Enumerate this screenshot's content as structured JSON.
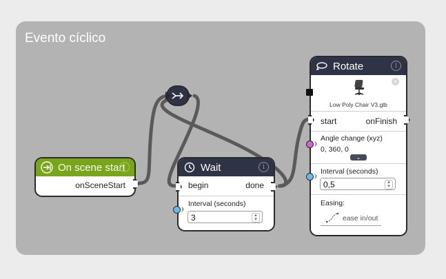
{
  "group": {
    "title": "Evento cíclico"
  },
  "nodes": {
    "on_scene_start": {
      "title": "On scene start",
      "output": "onSceneStart"
    },
    "wait": {
      "title": "Wait",
      "input": "begin",
      "output": "done",
      "interval_label": "Interval (seconds)",
      "interval_value": "3"
    },
    "rotate": {
      "title": "Rotate",
      "asset_name": "Low Poly Chair V3.glb",
      "input": "start",
      "output": "onFinish",
      "angle_label": "Angle change (xyz)",
      "angle_value": "0, 360, 0",
      "interval_label": "Interval (seconds)",
      "interval_value": "0,5",
      "easing_label": "Easing:",
      "easing_value": "ease in/out"
    }
  },
  "colors": {
    "group_bg": "#b3b3b3",
    "header_dark": "#2e3345",
    "header_green": "#77a61a",
    "port_number": "#5bc0eb",
    "port_vector": "#d563d6",
    "wire": "#5a5a5a"
  },
  "icons": {
    "on_scene_start": "enter-arrow-icon",
    "wait": "clock-icon",
    "rotate": "rotate-icon",
    "merge": "merge-arrows-icon",
    "info": "info-icon",
    "remove": "close-circle-icon",
    "chevron": "chevron-down-icon",
    "easing": "easing-curve-icon",
    "asset": "office-chair-icon"
  }
}
